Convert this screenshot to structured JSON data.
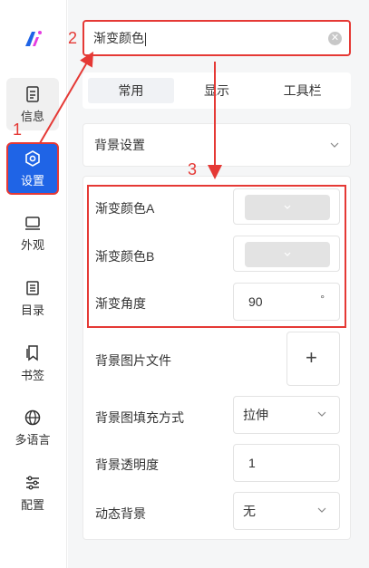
{
  "sidebar": {
    "items": [
      {
        "label": "信息",
        "icon": "document-icon"
      },
      {
        "label": "设置",
        "icon": "gear-icon"
      },
      {
        "label": "外观",
        "icon": "monitor-icon"
      },
      {
        "label": "目录",
        "icon": "list-icon"
      },
      {
        "label": "书签",
        "icon": "bookmark-icon"
      },
      {
        "label": "多语言",
        "icon": "globe-icon"
      },
      {
        "label": "配置",
        "icon": "sliders-icon"
      }
    ]
  },
  "search": {
    "value": "渐变颜色"
  },
  "tabs": [
    {
      "label": "常用"
    },
    {
      "label": "显示"
    },
    {
      "label": "工具栏"
    }
  ],
  "section": {
    "title": "背景设置"
  },
  "settings": {
    "gradient_a": {
      "label": "渐变颜色A"
    },
    "gradient_b": {
      "label": "渐变颜色B"
    },
    "gradient_angle": {
      "label": "渐变角度",
      "value": "90",
      "unit": "°"
    },
    "bg_image": {
      "label": "背景图片文件",
      "button": "+"
    },
    "fill_mode": {
      "label": "背景图填充方式",
      "value": "拉伸"
    },
    "opacity": {
      "label": "背景透明度",
      "value": "1"
    },
    "dynamic": {
      "label": "动态背景",
      "value": "无"
    }
  },
  "annotations": {
    "one": "1",
    "two": "2",
    "three": "3"
  },
  "colors": {
    "accent": "#1f64e6",
    "annotation": "#e53935"
  }
}
